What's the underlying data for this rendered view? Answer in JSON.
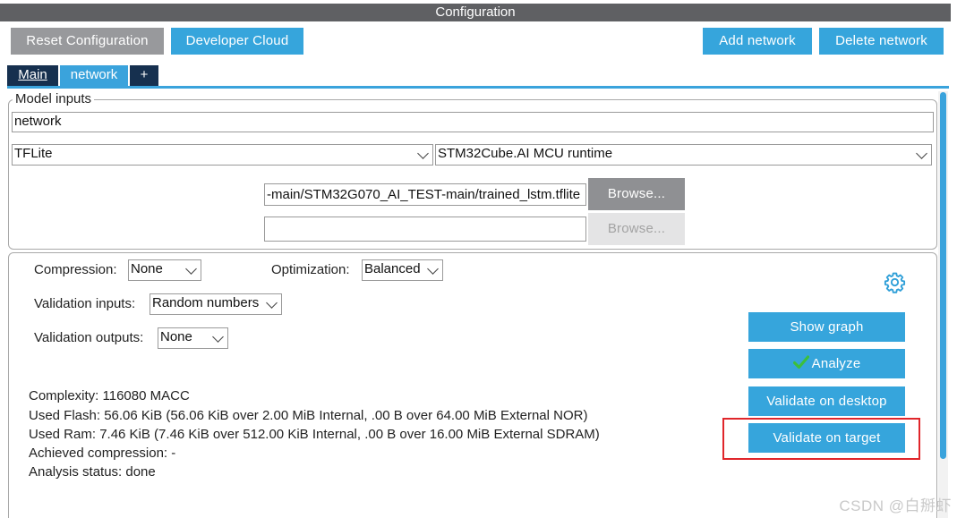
{
  "window": {
    "title": "Configuration"
  },
  "toolbar": {
    "reset_label": "Reset Configuration",
    "cloud_label": "Developer Cloud",
    "add_label": "Add network",
    "delete_label": "Delete network"
  },
  "tabs": [
    {
      "label": "Main"
    },
    {
      "label": "network"
    },
    {
      "label": "+"
    }
  ],
  "model_inputs": {
    "legend": "Model inputs",
    "name_value": "network",
    "framework": "TFLite",
    "runtime": "STM32Cube.AI MCU runtime",
    "model_path": "-main/STM32G070_AI_TEST-main/trained_lstm.tflite",
    "browse_label": "Browse...",
    "second_path": "",
    "browse2_label": "Browse..."
  },
  "settings": {
    "compression_label": "Compression:",
    "compression_value": "None",
    "optimization_label": "Optimization:",
    "optimization_value": "Balanced",
    "val_inputs_label": "Validation inputs:",
    "val_inputs_value": "Random numbers",
    "val_outputs_label": "Validation outputs:",
    "val_outputs_value": "None"
  },
  "actions": {
    "show_graph": "Show graph",
    "analyze": "Analyze",
    "validate_desktop": "Validate on desktop",
    "validate_target": "Validate on target"
  },
  "stats": {
    "complexity": "Complexity:  116080 MACC",
    "flash": "Used Flash: 56.06 KiB (56.06 KiB over 2.00 MiB Internal, .00 B over 64.00 MiB External NOR)",
    "ram": "Used Ram: 7.46 KiB (7.46 KiB over 512.00 KiB Internal, .00 B over 16.00 MiB External SDRAM)",
    "compression": "Achieved compression: -",
    "status": "Analysis status: done"
  },
  "watermark": "CSDN @白掰虾",
  "colors": {
    "accent": "#36a5dc",
    "navy": "#16304f",
    "highlight": "#e0262b",
    "check": "#3cbf3c"
  }
}
